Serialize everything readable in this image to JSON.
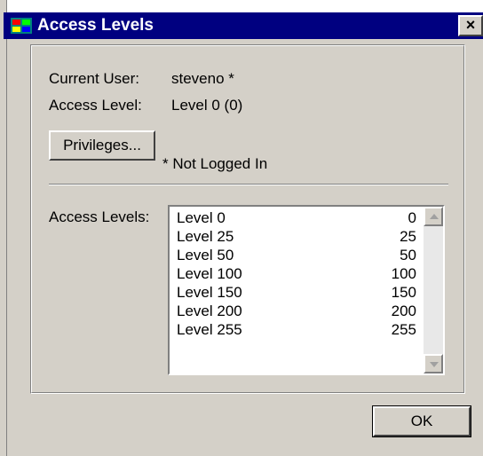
{
  "window": {
    "title": "Access Levels",
    "close_glyph": "×"
  },
  "user_info": {
    "current_user_label": "Current User:",
    "current_user_value": "steveno *",
    "access_level_label": "Access Level:",
    "access_level_value": "Level 0 (0)"
  },
  "privileges_button": "Privileges...",
  "not_logged_in_note": "* Not Logged In",
  "access_levels": {
    "label": "Access Levels:",
    "items": [
      {
        "name": "Level 0",
        "value": "0"
      },
      {
        "name": "Level 25",
        "value": "25"
      },
      {
        "name": "Level 50",
        "value": "50"
      },
      {
        "name": "Level 100",
        "value": "100"
      },
      {
        "name": "Level 150",
        "value": "150"
      },
      {
        "name": "Level 200",
        "value": "200"
      },
      {
        "name": "Level 255",
        "value": "255"
      }
    ]
  },
  "ok_button": "OK",
  "icons": {
    "title": "app-icon",
    "scroll_up": "scroll-up-arrow-icon",
    "scroll_down": "scroll-down-arrow-icon"
  },
  "colors": {
    "titlebar": "#000080",
    "dialog": "#d4d0c8"
  }
}
